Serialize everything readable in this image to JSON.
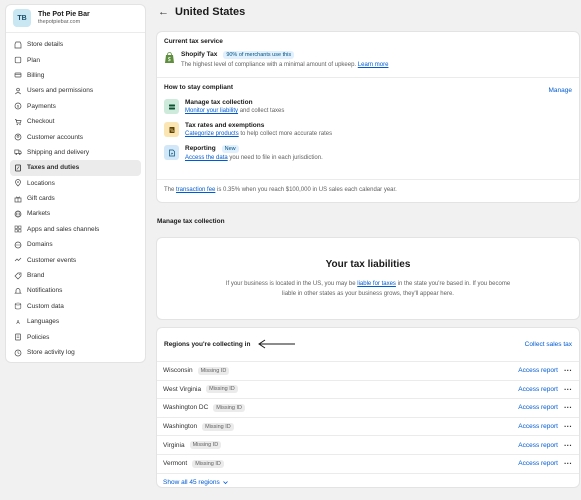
{
  "store": {
    "initials": "TB",
    "name": "The Pot Pie Bar",
    "domain": "thepotpiebar.com"
  },
  "nav": [
    {
      "label": "Store details",
      "icon": "store-icon"
    },
    {
      "label": "Plan",
      "icon": "plan-icon"
    },
    {
      "label": "Billing",
      "icon": "billing-icon"
    },
    {
      "label": "Users and permissions",
      "icon": "user-icon"
    },
    {
      "label": "Payments",
      "icon": "payments-icon"
    },
    {
      "label": "Checkout",
      "icon": "checkout-icon"
    },
    {
      "label": "Customer accounts",
      "icon": "customer-icon"
    },
    {
      "label": "Shipping and delivery",
      "icon": "truck-icon"
    },
    {
      "label": "Taxes and duties",
      "icon": "tax-icon",
      "active": true
    },
    {
      "label": "Locations",
      "icon": "location-icon"
    },
    {
      "label": "Gift cards",
      "icon": "gift-icon"
    },
    {
      "label": "Markets",
      "icon": "globe-icon"
    },
    {
      "label": "Apps and sales channels",
      "icon": "apps-icon"
    },
    {
      "label": "Domains",
      "icon": "domain-icon"
    },
    {
      "label": "Customer events",
      "icon": "events-icon"
    },
    {
      "label": "Brand",
      "icon": "brand-icon"
    },
    {
      "label": "Notifications",
      "icon": "bell-icon"
    },
    {
      "label": "Custom data",
      "icon": "data-icon"
    },
    {
      "label": "Languages",
      "icon": "language-icon"
    },
    {
      "label": "Policies",
      "icon": "policy-icon"
    },
    {
      "label": "Store activity log",
      "icon": "log-icon"
    }
  ],
  "page": {
    "title": "United States"
  },
  "current_tax": {
    "heading": "Current tax service",
    "service_name": "Shopify Tax",
    "badge": "90% of merchants use this",
    "description": "The highest level of compliance with a minimal amount of upkeep.",
    "learn_more": "Learn more",
    "manage": "Manage"
  },
  "compliant": {
    "heading": "How to stay compliant",
    "items": [
      {
        "title": "Manage tax collection",
        "link": "Monitor your liability",
        "rest": " and collect taxes"
      },
      {
        "title": "Tax rates and exemptions",
        "link": "Categorize products",
        "rest": " to help collect more accurate rates"
      },
      {
        "title": "Reporting",
        "badge": "New",
        "link": "Access the data",
        "rest": " you need to file in each jurisdiction."
      }
    ]
  },
  "fee_note": {
    "pre": "The ",
    "link": "transaction fee",
    "post": " is 0.35% when you reach $100,000 in US sales each calendar year."
  },
  "manage_heading": "Manage tax collection",
  "liabilities": {
    "title": "Your tax liabilities",
    "text_pre": "If your business is located in the US, you may be ",
    "link": "liable for taxes",
    "text_post": " in the state you're based in. If you become liable in other states as your business grows, they'll appear here."
  },
  "regions": {
    "heading": "Regions you're collecting in",
    "collect_link": "Collect sales tax",
    "rows": [
      {
        "name": "Wisconsin",
        "badge": "Missing ID",
        "action": "Access report"
      },
      {
        "name": "West Virginia",
        "badge": "Missing ID",
        "action": "Access report"
      },
      {
        "name": "Washington DC",
        "badge": "Missing ID",
        "action": "Access report"
      },
      {
        "name": "Washington",
        "badge": "Missing ID",
        "action": "Access report"
      },
      {
        "name": "Virginia",
        "badge": "Missing ID",
        "action": "Access report"
      },
      {
        "name": "Vermont",
        "badge": "Missing ID",
        "action": "Access report"
      }
    ],
    "show_all": "Show all 45 regions"
  },
  "colors": {
    "link": "#005bd3",
    "background": "#f1f1f1",
    "active_nav": "#ebebeb"
  }
}
